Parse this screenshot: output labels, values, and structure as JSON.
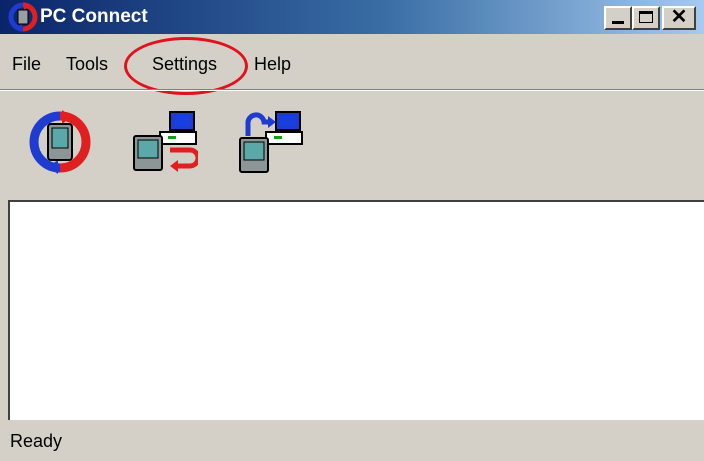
{
  "window": {
    "title": "PC Connect"
  },
  "menu": {
    "items": [
      "File",
      "Tools",
      "Settings",
      "Help"
    ]
  },
  "toolbar": {
    "buttons": [
      "sync-icon",
      "restore-icon",
      "backup-icon"
    ]
  },
  "status": {
    "text": "Ready"
  },
  "annotation": {
    "highlighted_item": "Settings",
    "color": "#e0121b"
  },
  "colors": {
    "title_start": "#0a246a",
    "title_end": "#a6caf0",
    "chrome": "#d4d0c8"
  }
}
